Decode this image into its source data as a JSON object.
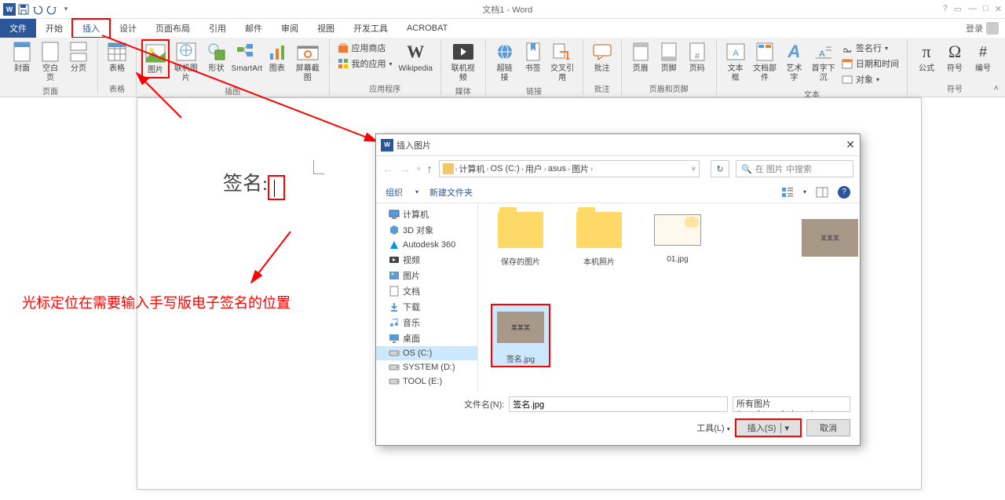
{
  "titlebar": {
    "doc_title": "文档1 - Word",
    "login": "登录"
  },
  "tabs": {
    "file": "文件",
    "home": "开始",
    "insert": "插入",
    "design": "设计",
    "layout": "页面布局",
    "references": "引用",
    "mailings": "邮件",
    "review": "审阅",
    "view": "视图",
    "developer": "开发工具",
    "acrobat": "ACROBAT"
  },
  "ribbon": {
    "groups": {
      "pages": "页面",
      "tables": "表格",
      "illustrations": "插图",
      "apps": "应用程序",
      "media": "媒体",
      "links": "链接",
      "comments": "批注",
      "headerfooter": "页眉和页脚",
      "text": "文本",
      "symbols": "符号"
    },
    "buttons": {
      "cover": "封面",
      "blank": "空白页",
      "pagebreak": "分页",
      "table": "表格",
      "picture": "图片",
      "onlinepic": "联机图片",
      "shapes": "形状",
      "smartart": "SmartArt",
      "chart": "图表",
      "screenshot": "屏幕截图",
      "store": "应用商店",
      "myapps": "我的应用",
      "wikipedia": "Wikipedia",
      "onlinevideo": "联机视频",
      "hyperlink": "超链接",
      "bookmark": "书签",
      "crossref": "交叉引用",
      "comment": "批注",
      "header": "页眉",
      "footer": "页脚",
      "pagenum": "页码",
      "textbox": "文本框",
      "quickparts": "文档部件",
      "wordart": "艺术字",
      "dropcap": "首字下沉",
      "sigline": "签名行",
      "datetime": "日期和时间",
      "object": "对象",
      "equation": "公式",
      "symbol": "符号",
      "number": "编号"
    }
  },
  "document": {
    "sign_label": "签名:"
  },
  "annotation": "光标定位在需要输入手写版电子签名的位置",
  "dialog": {
    "title": "插入图片",
    "breadcrumb": [
      "计算机",
      "OS (C:)",
      "用户",
      "asus",
      "图片"
    ],
    "search_placeholder": "在 图片 中搜索",
    "organize": "组织",
    "newfolder": "新建文件夹",
    "tree": [
      {
        "icon": "computer",
        "label": "计算机"
      },
      {
        "icon": "3d",
        "label": "3D 对象"
      },
      {
        "icon": "autodesk",
        "label": "Autodesk 360"
      },
      {
        "icon": "video",
        "label": "视频"
      },
      {
        "icon": "pictures",
        "label": "图片"
      },
      {
        "icon": "docs",
        "label": "文档"
      },
      {
        "icon": "downloads",
        "label": "下载"
      },
      {
        "icon": "music",
        "label": "音乐"
      },
      {
        "icon": "desktop",
        "label": "桌面"
      },
      {
        "icon": "drive",
        "label": "OS (C:)",
        "selected": true
      },
      {
        "icon": "drive",
        "label": "SYSTEM (D:)"
      },
      {
        "icon": "drive",
        "label": "TOOL (E:)"
      }
    ],
    "files": [
      {
        "type": "folder",
        "label": "保存的图片"
      },
      {
        "type": "folder",
        "label": "本机照片"
      },
      {
        "type": "image-pale",
        "label": "01.jpg"
      },
      {
        "type": "image",
        "label": "签名.jpg",
        "thumb_text": "某某某",
        "selected": true
      }
    ],
    "preview_text": "某某某",
    "filename_label": "文件名(N):",
    "filename_value": "签名.jpg",
    "filter": "所有图片(*.emf;*.wmf;*.jpg;*.j",
    "tools": "工具(L)",
    "insert": "插入(S)",
    "cancel": "取消"
  }
}
